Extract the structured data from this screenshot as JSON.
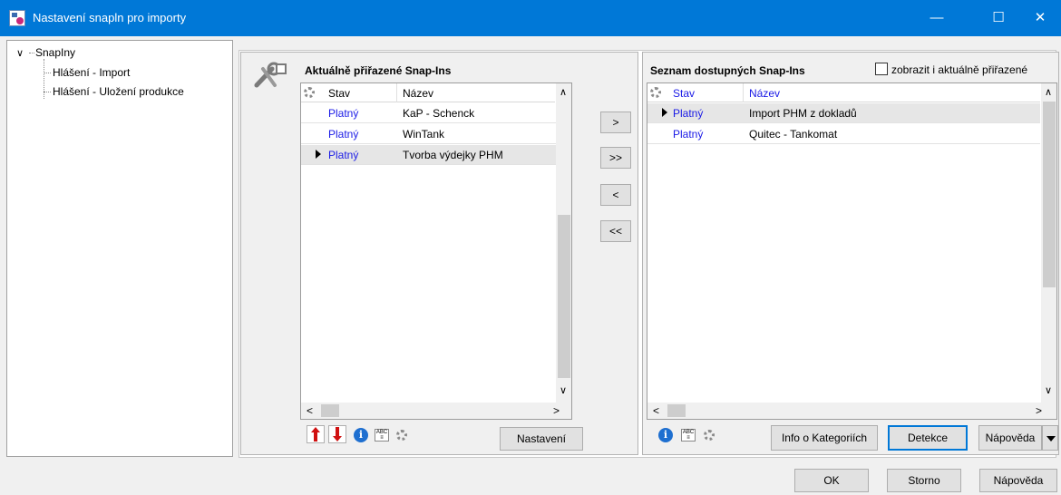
{
  "window": {
    "title": "Nastavení snapln pro importy",
    "minimize": "—",
    "maximize": "☐",
    "close": "✕"
  },
  "tree": {
    "root": "SnapIny",
    "items": [
      "Hlášení - Import",
      "Hlášení - Uložení produkce"
    ]
  },
  "left": {
    "header": "Aktuálně přiřazené Snap-Ins",
    "columns": {
      "stav": "Stav",
      "nazev": "Název"
    },
    "rows": [
      {
        "stav": "Platný",
        "nazev": "KaP - Schenck"
      },
      {
        "stav": "Platný",
        "nazev": "WinTank"
      },
      {
        "stav": "Platný",
        "nazev": "Tvorba výdejky PHM"
      }
    ],
    "settings_button": "Nastavení"
  },
  "move_buttons": {
    "add": ">",
    "add_all": ">>",
    "remove": "<",
    "remove_all": "<<"
  },
  "right": {
    "header": "Seznam dostupných Snap-Ins",
    "show_assigned_label": "zobrazit i aktuálně přiřazené",
    "columns": {
      "stav": "Stav",
      "nazev": "Název"
    },
    "rows": [
      {
        "stav": "Platný",
        "nazev": "Import PHM z dokladů"
      },
      {
        "stav": "Platný",
        "nazev": "Quitec - Tankomat"
      }
    ],
    "category_info_button": "Info o Kategoriích",
    "detect_button": "Detekce",
    "help_button": "Nápověda"
  },
  "footer": {
    "ok": "OK",
    "cancel": "Storno",
    "help": "Nápověda"
  },
  "colors": {
    "titlebar": "#0078d7",
    "link_blue": "#1a1ae6",
    "move_up": "#d01010"
  }
}
